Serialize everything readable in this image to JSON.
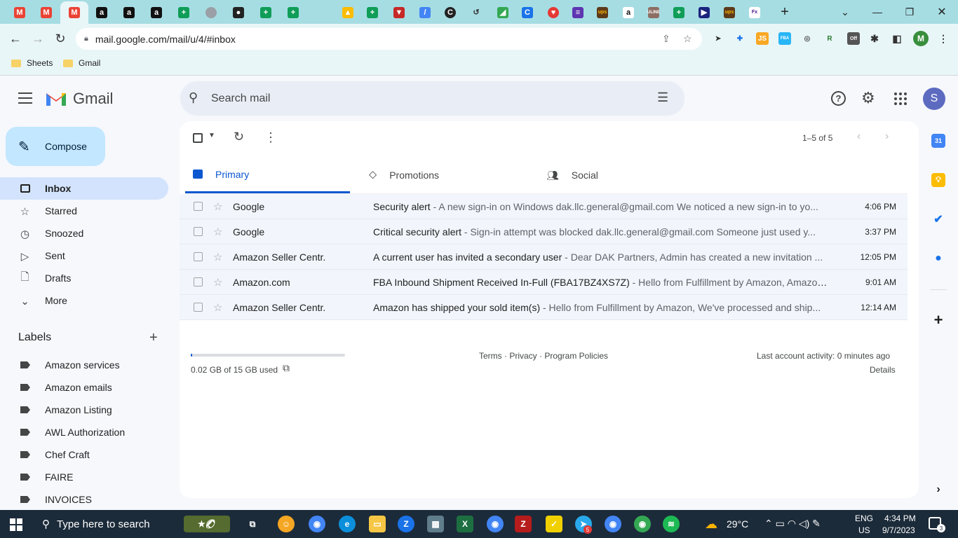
{
  "browser": {
    "url": "mail.google.com/mail/u/4/#inbox",
    "bookmarks": [
      "Sheets",
      "Gmail"
    ],
    "profile_initial": "M",
    "new_tab_symbol": "+"
  },
  "gmail": {
    "logo_text": "Gmail",
    "search_placeholder": "Search mail",
    "avatar_initial": "S",
    "compose_label": "Compose",
    "nav": [
      {
        "label": "Inbox",
        "icon": "inbox-icon"
      },
      {
        "label": "Starred",
        "icon": "star-icon"
      },
      {
        "label": "Snoozed",
        "icon": "clock-icon"
      },
      {
        "label": "Sent",
        "icon": "send-icon"
      },
      {
        "label": "Drafts",
        "icon": "draft-icon"
      },
      {
        "label": "More",
        "icon": "chevron-down-icon"
      }
    ],
    "labels_heading": "Labels",
    "labels": [
      "Amazon services",
      "Amazon emails",
      "Amazon Listing",
      "AWL Authorization",
      "Chef Craft",
      "FAIRE",
      "INVOICES"
    ],
    "pagination": "1–5 of 5",
    "tabs": [
      "Primary",
      "Promotions",
      "Social"
    ],
    "emails": [
      {
        "sender": "Google",
        "subject": "Security alert",
        "snippet": " - A new sign-in on Windows dak.llc.general@gmail.com We noticed a new sign-in to yo...",
        "time": "4:06 PM"
      },
      {
        "sender": "Google",
        "subject": "Critical security alert",
        "snippet": " - Sign-in attempt was blocked dak.llc.general@gmail.com Someone just used y...",
        "time": "3:37 PM"
      },
      {
        "sender": "Amazon Seller Centr.",
        "subject": "A current user has invited a secondary user",
        "snippet": " - Dear DAK Partners, Admin has created a new invitation ...",
        "time": "12:05 PM"
      },
      {
        "sender": "Amazon.com",
        "subject": "FBA Inbound Shipment Received In-Full (FBA17BZ4XS7Z)",
        "snippet": " - Hello from Fulfillment by Amazon, Amazon ...",
        "time": "9:01 AM"
      },
      {
        "sender": "Amazon Seller Centr.",
        "subject": "Amazon has shipped your sold item(s)",
        "snippet": " - Hello from Fulfillment by Amazon, We've processed and ship...",
        "time": "12:14 AM"
      }
    ],
    "storage": "0.02 GB of 15 GB used",
    "storage_fraction": 0.0013,
    "footer_links": "Terms · Privacy · Program Policies",
    "last_activity": "Last account activity: 0 minutes ago",
    "details": "Details"
  },
  "taskbar": {
    "search_placeholder": "Type here to search",
    "weather": "29°C",
    "lang": "ENG",
    "region": "US",
    "time": "4:34 PM",
    "date": "9/7/2023",
    "badge": "5",
    "notifications": "3"
  },
  "colors": {
    "accent": "#0b57d0",
    "selected_nav": "#d3e3fd",
    "compose": "#c2e7ff",
    "tabbar": "#a6dde3"
  }
}
